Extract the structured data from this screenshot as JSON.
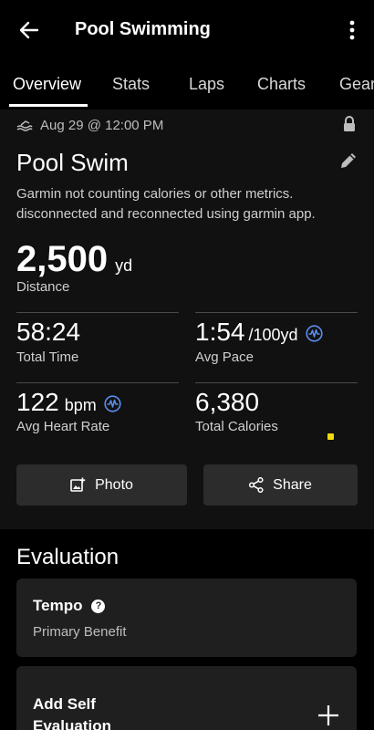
{
  "header": {
    "title": "Pool Swimming",
    "back_icon": "arrow-left-icon",
    "more_icon": "more-vertical-icon"
  },
  "tabs": [
    {
      "label": "Overview",
      "active": true
    },
    {
      "label": "Stats",
      "active": false
    },
    {
      "label": "Laps",
      "active": false
    },
    {
      "label": "Charts",
      "active": false
    },
    {
      "label": "Gear",
      "active": false
    }
  ],
  "activity": {
    "date": "Aug 29 @ 12:00 PM",
    "name": "Pool Swim",
    "notes": "Garmin not counting calories or other metrics. disconnected and reconnected using garmin app."
  },
  "distance": {
    "value": "2,500",
    "unit": "yd",
    "label": "Distance"
  },
  "stats": {
    "total_time": {
      "value": "58:24",
      "label": "Total Time"
    },
    "avg_pace": {
      "value": "1:54",
      "unit": "/100yd",
      "label": "Avg Pace"
    },
    "avg_hr": {
      "value": "122",
      "unit": "bpm",
      "label": "Avg Heart Rate"
    },
    "calories": {
      "value": "6,380",
      "label": "Total Calories"
    }
  },
  "actions": {
    "photo_label": "Photo",
    "share_label": "Share"
  },
  "evaluation": {
    "title": "Evaluation",
    "tempo_title": "Tempo",
    "tempo_sub": "Primary Benefit",
    "add_self": "Add Self Evaluation"
  },
  "colors": {
    "background": "#000000",
    "card": "#111111",
    "button": "#2c2c2c",
    "accent_icon": "#5b8def",
    "yellow": "#f0d90f"
  }
}
